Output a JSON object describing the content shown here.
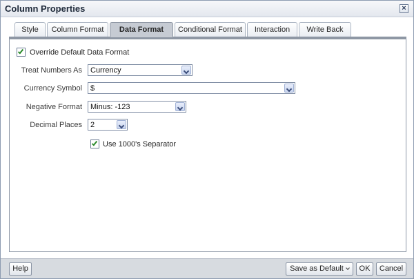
{
  "dialog": {
    "title": "Column Properties",
    "close_label": "×"
  },
  "tabs": [
    {
      "label": "Style"
    },
    {
      "label": "Column Format"
    },
    {
      "label": "Data Format"
    },
    {
      "label": "Conditional Format"
    },
    {
      "label": "Interaction"
    },
    {
      "label": "Write Back"
    }
  ],
  "active_tab": "Data Format",
  "form": {
    "override_label": "Override Default Data Format",
    "override_checked": true,
    "treat_numbers_as": {
      "label": "Treat Numbers As",
      "value": "Currency"
    },
    "currency_symbol": {
      "label": "Currency Symbol",
      "value": "$"
    },
    "negative_format": {
      "label": "Negative Format",
      "value": "Minus: -123"
    },
    "decimal_places": {
      "label": "Decimal Places",
      "value": "2"
    },
    "separator_label": "Use 1000's Separator",
    "separator_checked": true
  },
  "footer": {
    "help_label": "Help",
    "save_default_label": "Save as Default",
    "ok_label": "OK",
    "cancel_label": "Cancel"
  },
  "colors": {
    "check": "#2a8a2a",
    "active_tab": "#c6cbd3",
    "footer_bg": "#d7dbe0"
  }
}
